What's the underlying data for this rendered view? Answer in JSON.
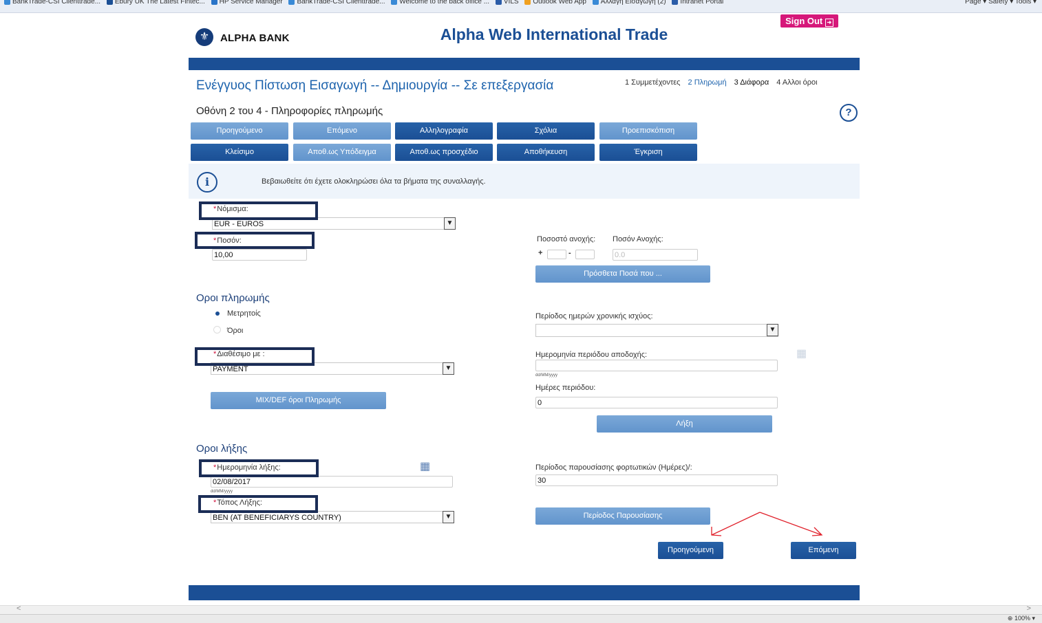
{
  "browser": {
    "favorites": [
      "BankTrade-CSI Clienttrade...",
      "Ebury UK The Latest Fintec...",
      "HP Service Manager",
      "BankTrade-CSI Clienttrade...",
      "Welcome to the back office ...",
      "VILS",
      "Outlook Web App",
      "Αλλαγή Εισαγωγή (2)",
      "Intranet Portal"
    ],
    "tools": "Page ▾  Safety ▾  Tools ▾",
    "zoom": "100%",
    "scroll_left": "<",
    "scroll_right": ">"
  },
  "header": {
    "bank_name": "ALPHA BANK",
    "app_title": "Alpha Web International Trade",
    "signout_label": "Sign Out"
  },
  "page": {
    "title": "Ενέγγυος Πίστωση Εισαγωγή -- Δημιουργία -- Σε επεξεργασία",
    "screen_title": "Οθόνη 2 του 4 - Πληροφορίες πληρωμής",
    "steps": [
      {
        "label": "1 Συμμετέχοντες",
        "active": false,
        "link": false
      },
      {
        "label": "2 Πληρωμή",
        "active": true,
        "link": true
      },
      {
        "label": "3 Διάφορα",
        "active": false,
        "link": false
      },
      {
        "label": "4 Αλλοι όροι",
        "active": false,
        "link": false
      }
    ],
    "help_label": "?"
  },
  "toolbar": {
    "row1": [
      "Προηγούμενο",
      "Επόμενο",
      "Αλληλογραφία",
      "Σχόλια",
      "Προεπισκόπιση"
    ],
    "row2": [
      "Κλείσιμο",
      "Αποθ.ως Υπόδειγμα",
      "Αποθ.ως προσχέδιο",
      "Αποθήκευση",
      "Έγκριση"
    ]
  },
  "info": {
    "icon": "i",
    "message": "Βεβαιωθείτε ότι έχετε ολοκληρώσει όλα τα βήματα της συναλλαγής."
  },
  "form": {
    "required_mark": "*",
    "currency_label": "Νόμισμα:",
    "currency_value": "EUR - EUROS",
    "amount_label": "Ποσόν:",
    "amount_value": "10,00",
    "tolerance_pct_label": "Ποσοστό ανοχής:",
    "tolerance_amt_label": "Ποσόν Ανοχής:",
    "plus": "+",
    "minus": "-",
    "tolerance_amt_placeholder": "0.0",
    "additional_amounts_button": "Πρόσθετα Ποσά που ...",
    "payment_terms_heading": "Οροι πληρωμής",
    "radio_cash": "Μετρητοίς",
    "radio_terms": "Όροι",
    "validity_period_label": "Περίοδος ημερών χρονικής ισχύος:",
    "validity_period_value": "",
    "available_with_label": "Διαθέσιμο με :",
    "available_with_value": "PAYMENT",
    "acceptance_date_label": "Ημερομηνία περιόδου αποδοχής:",
    "date_format": "dd/MM/yyyy",
    "period_days_label": "Ημέρες περιόδου:",
    "period_days_value": "0",
    "mixdef_button": "MIX/DEF όροι Πληρωμής",
    "expiry_button": "Λήξη",
    "expiry_terms_heading": "Οροι λήξης",
    "expiry_date_label": "Ημερομηνία λήξης:",
    "expiry_date_value": "02/08/2017",
    "presentation_period_label": "Περίοδος παρουσίασης φορτωτικών (Ημέρες)/:",
    "presentation_period_value": "30",
    "expiry_place_label": "Τόπος Λήξης:",
    "expiry_place_value": "BEN (AT BENEFICIARYS COUNTRY)",
    "presentation_button": "Περίοδος Παρουσίασης",
    "prev_button": "Προηγούμενη",
    "next_button": "Επόμενη"
  },
  "colors": {
    "brand_blue": "#1b4f95",
    "light_button": "#6f9fd2",
    "signout_pink": "#d6187a",
    "annotation_box": "#1b2d56",
    "annotation_arrow": "#e0202a"
  }
}
